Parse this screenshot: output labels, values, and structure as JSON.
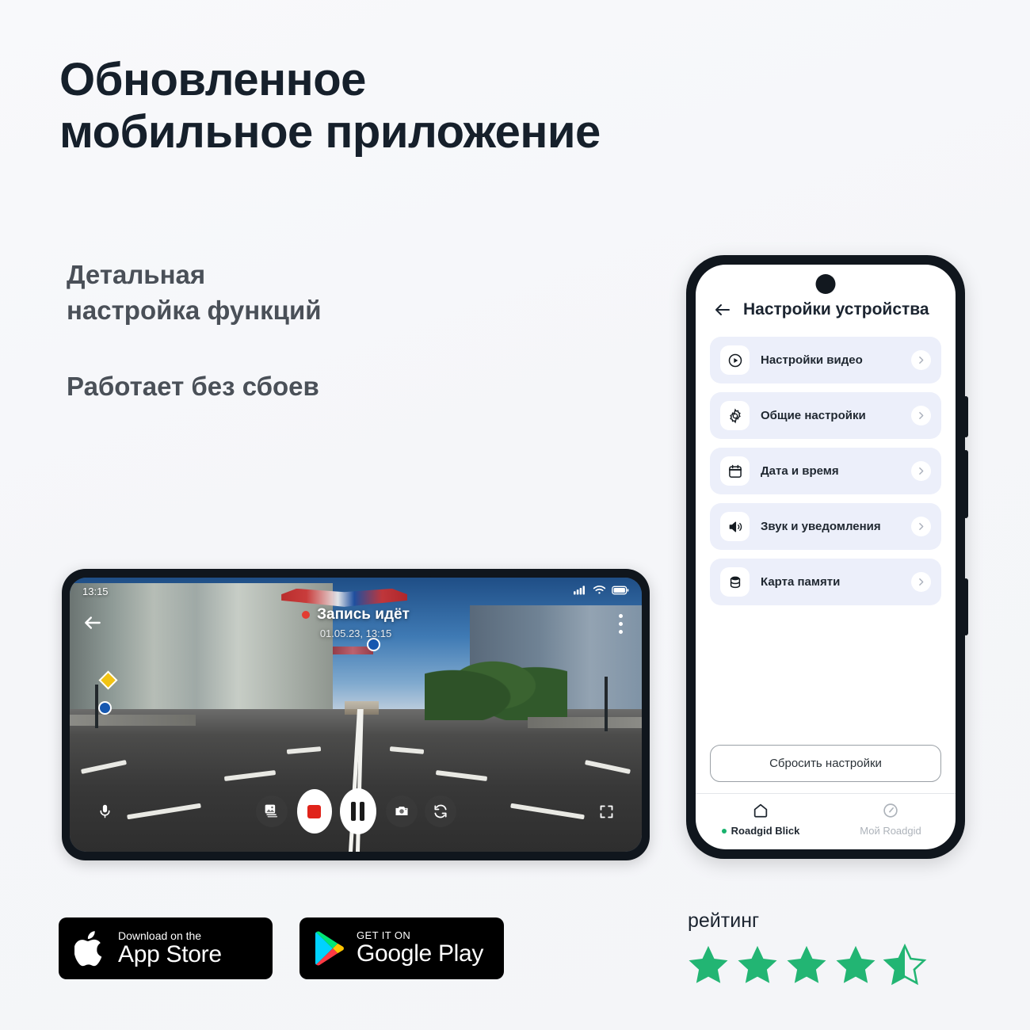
{
  "page": {
    "headline": "Обновленное\nмобильное приложение",
    "feature_1": "Детальная\nнастройка функций",
    "feature_2": "Работает без сбоев",
    "bg_color": "#f6f7fa",
    "headline_color": "#16202b",
    "feature_color": "#4a5058"
  },
  "dashcam": {
    "status_time": "13:15",
    "recording_title": "Запись идёт",
    "recording_datetime": "01.05.23, 13:15",
    "record_dot_color": "#e23c32",
    "status_icons": [
      "signal-icon",
      "wifi-icon",
      "battery-icon"
    ],
    "overflow_icon": "more-vertical-icon",
    "back_icon": "back-arrow-icon",
    "controls": [
      {
        "name": "microphone-button",
        "icon": "microphone-icon"
      },
      {
        "name": "gallery-button",
        "icon": "gallery-icon"
      },
      {
        "name": "record-button",
        "icon": "record-icon"
      },
      {
        "name": "pause-button",
        "icon": "pause-icon"
      },
      {
        "name": "photo-button",
        "icon": "camera-icon"
      },
      {
        "name": "switch-camera-button",
        "icon": "switch-camera-icon"
      },
      {
        "name": "fullscreen-button",
        "icon": "fullscreen-icon"
      }
    ]
  },
  "settings_phone": {
    "header_title": "Настройки устройства",
    "back_icon": "back-arrow-icon",
    "rows": [
      {
        "label": "Настройки видео",
        "icon": "play-circle-icon"
      },
      {
        "label": "Общие настройки",
        "icon": "gear-icon"
      },
      {
        "label": "Дата и время",
        "icon": "calendar-icon"
      },
      {
        "label": "Звук и уведомления",
        "icon": "speaker-icon"
      },
      {
        "label": "Карта памяти",
        "icon": "database-icon"
      }
    ],
    "reset_label": "Сбросить настройки",
    "row_bg": "#eceffa",
    "tabs": [
      {
        "label": "Roadgid Blick",
        "icon": "home-icon",
        "active": true,
        "dot_color": "#18b26d"
      },
      {
        "label": "Мой Roadgid",
        "icon": "gauge-icon",
        "active": false,
        "dot_color": ""
      }
    ]
  },
  "store_badges": {
    "apple": {
      "small": "Download on the",
      "big": "App Store",
      "icon": "apple-icon"
    },
    "google": {
      "small": "GET IT ON",
      "big": "Google Play",
      "icon": "google-play-icon"
    }
  },
  "rating": {
    "label": "рейтинг",
    "value": 4.5,
    "max": 5,
    "star_color": "#22b573"
  }
}
